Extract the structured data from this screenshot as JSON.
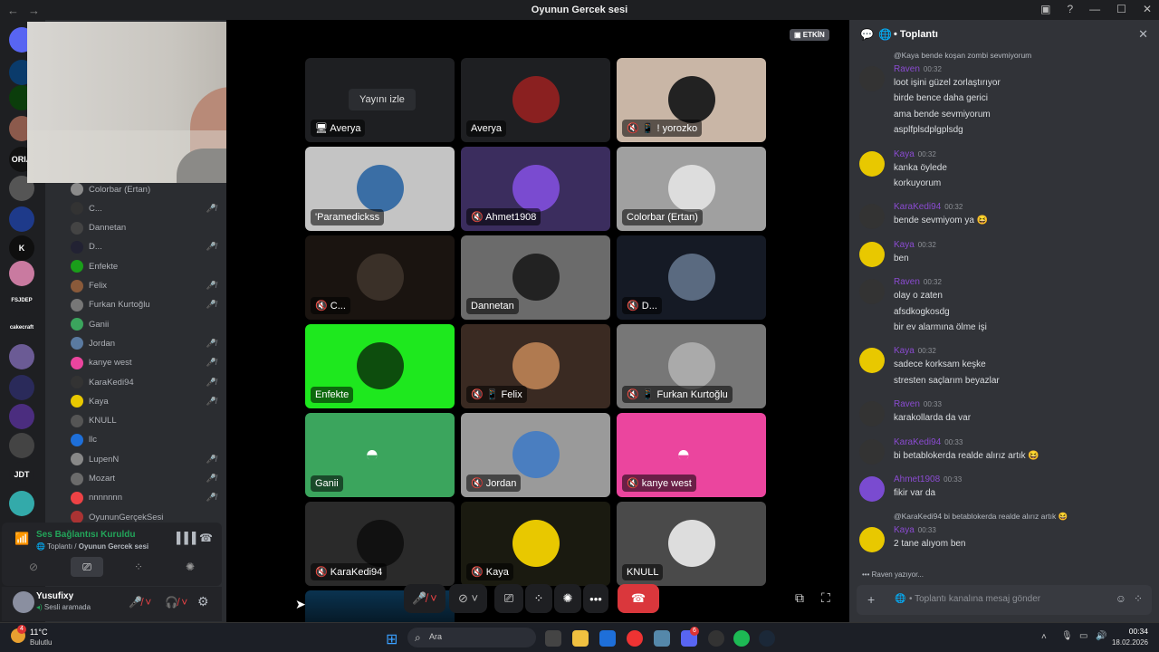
{
  "window": {
    "title": "Oyunun Gercek sesi"
  },
  "servers": [
    {
      "name": "discord-home-icon",
      "label": "",
      "color": "#5865f2"
    },
    {
      "name": "server-1",
      "label": "",
      "color": "#0a3b6b"
    },
    {
      "name": "server-biohazard",
      "label": "",
      "color": "#0b3d0b"
    },
    {
      "name": "server-3",
      "label": "",
      "color": "#8c5a4c"
    },
    {
      "name": "server-oria",
      "label": "ORIA",
      "color": "#111"
    },
    {
      "name": "server-5",
      "label": "",
      "color": "#555"
    },
    {
      "name": "server-6",
      "label": "",
      "color": "#1e3a8a"
    },
    {
      "name": "server-kick",
      "label": "K",
      "color": "#0f0f0f"
    },
    {
      "name": "server-8",
      "label": "",
      "color": "#c97aa0"
    },
    {
      "name": "server-fsjdep",
      "label": "FSJDEP",
      "color": "#1e1f22"
    },
    {
      "name": "server-cakecraft",
      "label": "cakecraft",
      "color": "#1e1f22"
    },
    {
      "name": "server-11",
      "label": "",
      "color": "#6b5b95"
    },
    {
      "name": "server-12",
      "label": "",
      "color": "#2a2a5a"
    },
    {
      "name": "server-13",
      "label": "",
      "color": "#4b2d7f"
    },
    {
      "name": "server-14",
      "label": "",
      "color": "#444"
    },
    {
      "name": "server-jdt",
      "label": "JDT",
      "color": "#1e1f22"
    },
    {
      "name": "server-16",
      "label": "",
      "color": "#3aa"
    }
  ],
  "members": [
    {
      "name": "Colorbar (Ertan)",
      "color": "#8b8b8b",
      "muted": false
    },
    {
      "name": "C...",
      "color": "#333",
      "muted": true
    },
    {
      "name": "Dannetan",
      "color": "#444",
      "muted": false
    },
    {
      "name": "D...",
      "color": "#223",
      "muted": true
    },
    {
      "name": "Enfekte",
      "color": "#1a9e1a",
      "muted": false
    },
    {
      "name": "Felix",
      "color": "#8a5a3a",
      "muted": true
    },
    {
      "name": "Furkan Kurtoğlu",
      "color": "#777",
      "muted": true
    },
    {
      "name": "Ganii",
      "color": "#3ba55d",
      "muted": false
    },
    {
      "name": "Jordan",
      "color": "#5a7aa0",
      "muted": true
    },
    {
      "name": "kanye west",
      "color": "#eb459e",
      "muted": true
    },
    {
      "name": "KaraKedi94",
      "color": "#333",
      "muted": true
    },
    {
      "name": "Kaya",
      "color": "#e8c800",
      "muted": true
    },
    {
      "name": "KNULL",
      "color": "#555",
      "muted": false
    },
    {
      "name": "llc",
      "color": "#1e6fd9",
      "muted": false
    },
    {
      "name": "LupenN",
      "color": "#888",
      "muted": true
    },
    {
      "name": "Mozart",
      "color": "#6b6b6b",
      "muted": true
    },
    {
      "name": "nnnnnnn",
      "color": "#ed4245",
      "muted": true
    },
    {
      "name": "OyununGerçekSesi",
      "color": "#aa3333",
      "muted": false
    }
  ],
  "voice": {
    "status": "Ses Bağlantısı Kuruldu",
    "channel": "Toplantı",
    "server": "Oyunun Gercek sesi",
    "sep": " / "
  },
  "user": {
    "name": "Yusufixy",
    "status": "Sesli aramada"
  },
  "stage": {
    "live_badge": "ETKİN",
    "watch_stream": "Yayını izle"
  },
  "tiles": [
    {
      "label": "Averya",
      "bg": "#1e1f22",
      "avatar": "",
      "prefix": "🖥 "
    },
    {
      "label": "Averya",
      "bg": "#1e1f22",
      "avatar": "#8a2020",
      "prefix": ""
    },
    {
      "label": "! yorozko",
      "bg": "#c9b6a6",
      "avatar": "#222",
      "prefix": "🔇 📱 "
    },
    {
      "label": "'Paramedickss",
      "bg": "#c4c4c4",
      "avatar": "#3a6ea5",
      "prefix": ""
    },
    {
      "label": "Ahmet1908",
      "bg": "#3b2d5e",
      "avatar": "#7a4bd0",
      "prefix": "🔇 "
    },
    {
      "label": "Colorbar (Ertan)",
      "bg": "#a0a0a0",
      "avatar": "#ddd",
      "prefix": ""
    },
    {
      "label": "C...",
      "bg": "#1a1410",
      "avatar": "#3a3028",
      "prefix": "🔇 "
    },
    {
      "label": "Dannetan",
      "bg": "#6b6b6b",
      "avatar": "#222",
      "prefix": ""
    },
    {
      "label": "D...",
      "bg": "#151a25",
      "avatar": "#5a6a80",
      "prefix": "🔇 "
    },
    {
      "label": "Enfekte",
      "bg": "#1ee81e",
      "avatar": "#0d4d0d",
      "prefix": ""
    },
    {
      "label": "Felix",
      "bg": "#3a2a22",
      "avatar": "#b07a50",
      "prefix": "🔇 📱 "
    },
    {
      "label": "Furkan Kurtoğlu",
      "bg": "#777",
      "avatar": "#aaa",
      "prefix": "🔇 📱 "
    },
    {
      "label": "Ganii",
      "bg": "#3ba55d",
      "avatar": "",
      "prefix": "",
      "discord": true
    },
    {
      "label": "Jordan",
      "bg": "#9a9a9a",
      "avatar": "#4a7ec0",
      "prefix": "🔇 "
    },
    {
      "label": "kanye west",
      "bg": "#eb459e",
      "avatar": "",
      "prefix": "🔇 ",
      "discord": true
    },
    {
      "label": "KaraKedi94",
      "bg": "#2a2a2a",
      "avatar": "#111",
      "prefix": "🔇 "
    },
    {
      "label": "Kaya",
      "bg": "#1a1a10",
      "avatar": "#e8c800",
      "prefix": "🔇 "
    },
    {
      "label": "KNULL",
      "bg": "#4a4a4a",
      "avatar": "#ddd",
      "prefix": ""
    }
  ],
  "chat": {
    "header": "Toplantı",
    "input_placeholder": "Toplantı kanalına mesaj gönder",
    "typing": "Raven yazıyor...",
    "messages": [
      {
        "reply": "@Kaya bende koşan zombi sevmiyorum",
        "name": "Raven",
        "color": "#8a4bd0",
        "time": "00:32",
        "av": "#333",
        "lines": [
          "loot işini güzel zorlaştırıyor",
          "birde bence daha gerici",
          "ama bende sevmiyorum",
          "asplfplsdplgplsdg"
        ]
      },
      {
        "name": "Kaya",
        "color": "#8a4bd0",
        "time": "00:32",
        "av": "#e8c800",
        "lines": [
          "kanka öylede",
          "korkuyorum"
        ]
      },
      {
        "name": "KaraKedi94",
        "color": "#8a4bd0",
        "time": "00:32",
        "av": "#333",
        "lines": [
          "bende sevmiyom ya 😆"
        ]
      },
      {
        "name": "Kaya",
        "color": "#8a4bd0",
        "time": "00:32",
        "av": "#e8c800",
        "lines": [
          "ben"
        ]
      },
      {
        "name": "Raven",
        "color": "#8a4bd0",
        "time": "00:32",
        "av": "#333",
        "lines": [
          "olay o zaten",
          "afsdkogkosdg",
          "bir ev alarmına ölme işi"
        ]
      },
      {
        "name": "Kaya",
        "color": "#8a4bd0",
        "time": "00:32",
        "av": "#e8c800",
        "lines": [
          "sadece korksam keşke",
          "stresten saçlarım beyazlar"
        ]
      },
      {
        "name": "Raven",
        "color": "#8a4bd0",
        "time": "00:33",
        "av": "#333",
        "lines": [
          "karakollarda da var"
        ]
      },
      {
        "name": "KaraKedi94",
        "color": "#8a4bd0",
        "time": "00:33",
        "av": "#333",
        "lines": [
          "bi betablokerda realde alırız artık 😆"
        ]
      },
      {
        "name": "Ahmet1908",
        "color": "#8a4bd0",
        "time": "00:33",
        "av": "#7a4bd0",
        "lines": [
          "fikir var da"
        ]
      },
      {
        "reply": "@KaraKedi94 bi betablokerda realde alırız artık 😆",
        "name": "Kaya",
        "color": "#8a4bd0",
        "time": "00:33",
        "av": "#e8c800",
        "lines": [
          "2 tane alıyom ben"
        ]
      }
    ]
  },
  "taskbar": {
    "weather_temp": "11°C",
    "weather_desc": "Bulutlu",
    "search": "Ara",
    "time": "00:34",
    "date": "18.02.2026",
    "badge": "4",
    "discord_badge": "6"
  }
}
